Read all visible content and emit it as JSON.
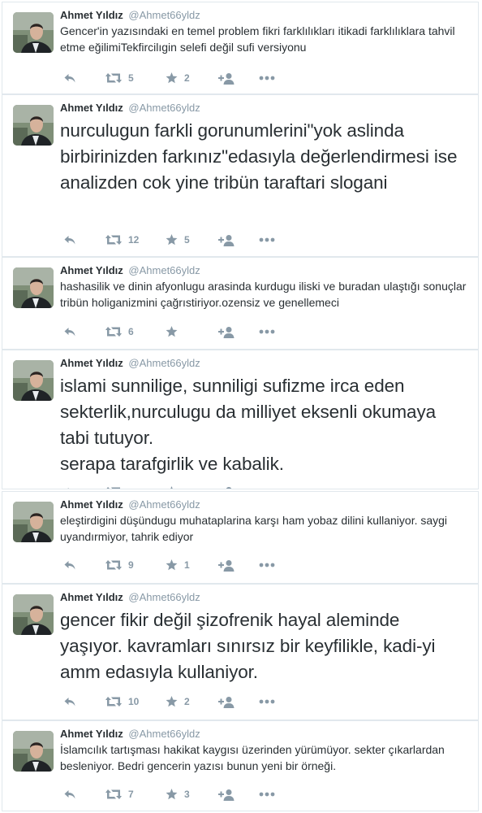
{
  "tweets": [
    {
      "name": "Ahmet Yıldız",
      "handle": "@Ahmet66yldz",
      "text": "Gencer'in yazısındaki en temel problem fikri farklılıkları itikadi farklılıklara tahvil etme eğilimiTekfircilıgin selefi değil sufi versiyonu",
      "retweets": "5",
      "favorites": "2"
    },
    {
      "name": "Ahmet Yıldız",
      "handle": "@Ahmet66yldz",
      "text": "nurculugun farkli gorunumlerini\"yok aslinda birbirinizden farkınız\"edasıyla değerlendirmesi ise analizden cok  yine tribün taraftari slogani",
      "retweets": "12",
      "favorites": "5"
    },
    {
      "name": "Ahmet Yıldız",
      "handle": "@Ahmet66yldz",
      "text": "hashasilik ve dinin afyonlugu arasinda kurdugu iliski ve buradan ulaştığı sonuçlar tribün holiganizmini çağrıstiriyor.ozensiz ve genellemeci",
      "retweets": "6",
      "favorites": ""
    },
    {
      "name": "Ahmet Yıldız",
      "handle": "@Ahmet66yldz",
      "text": "islami sunnilige, sunniligi sufizme irca eden sekterlik,nurculugu da milliyet eksenli okumaya tabi tutuyor.\nserapa tarafgirlik ve kabalik.",
      "retweets": "",
      "favorites": ""
    },
    {
      "name": "Ahmet Yıldız",
      "handle": "@Ahmet66yldz",
      "text": "eleştirdigini düşündugu muhataplarina karşı ham yobaz dilini kullaniyor. saygi uyandırmiyor, tahrik ediyor",
      "retweets": "9",
      "favorites": "1"
    },
    {
      "name": "Ahmet Yıldız",
      "handle": "@Ahmet66yldz",
      "text": "gencer fikir değil şizofrenik hayal aleminde yaşıyor. kavramları sınırsız bir keyfilikle, kadi-yi amm edasıyla kullaniyor.",
      "retweets": "10",
      "favorites": "2"
    },
    {
      "name": "Ahmet Yıldız",
      "handle": "@Ahmet66yldz",
      "text": "İslamcılık tartışması hakikat kaygısı üzerinden yürümüyor. sekter çıkarlardan besleniyor. Bedri gencerin yazısı bunun yeni bir örneği.",
      "retweets": "7",
      "favorites": "3"
    }
  ],
  "colors": {
    "text": "#292f33",
    "muted": "#8899a6",
    "border": "#e1e8ed"
  }
}
